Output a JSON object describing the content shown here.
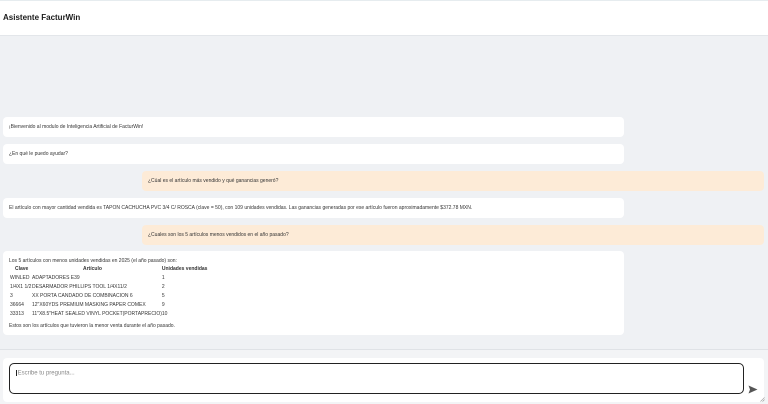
{
  "app": {
    "title": "Asistente FacturWin"
  },
  "messages": {
    "m1": "¡Bienvenido al modulo de Inteligencia Artificial de FacturWin!",
    "m2": "¿En qué le puedo ayudar?",
    "m3": "¿Cúal es el artículo más vendido y qué ganancias generó?",
    "m4": "El artículo con mayor cantidad vendida es TAPON CACHUCHA PVC 3/4 C/ ROSCA (clave = 50), con 109 unidades vendidas. Las ganancias generadas por ese artículo fueron aproximadamente $372.78 MXN.",
    "m5": "¿Cuales son los 5 artículos menos vendidos en el año pasado?",
    "m6": {
      "intro": "Los 5 artículos con menos unidades vendidas en 2025 (el año pasado) son:",
      "headers": {
        "clave": "Clave",
        "articulo": "Artículo",
        "unidades": "Unidades vendidas"
      },
      "rows": [
        {
          "clave": "WINLED",
          "articulo": "ADAPTADORES E39",
          "unidades": "1"
        },
        {
          "clave": "1/4X1 1/2",
          "articulo": "DESARMADOR PHILLIPS TOOL 1/4X11/2",
          "unidades": "2"
        },
        {
          "clave": "3",
          "articulo": "XX PORTA CANDADO DE COMBINACION 6",
          "unidades": "5"
        },
        {
          "clave": "36664",
          "articulo": "12\"X60YDS PREMIUM MASKING PAPER COMEX",
          "unidades": "9"
        },
        {
          "clave": "33313",
          "articulo": "11\"X8.5\"HEAT SEALED VINYL POCKET(PORTAPRECIO)",
          "unidades": "10"
        }
      ],
      "outro": "Estos son los artículos que tuvieron la menor venta durante el año pasado."
    }
  },
  "input": {
    "placeholder": "Escribe tu pregunta..."
  },
  "icons": {
    "send": "send-icon",
    "resize": "resize-handle-icon"
  }
}
